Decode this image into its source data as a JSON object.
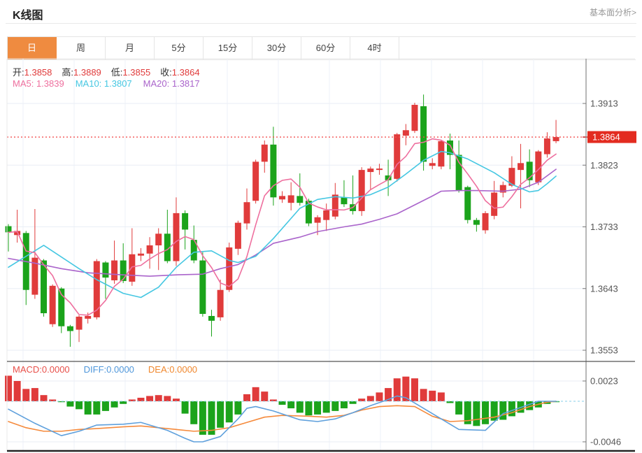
{
  "page": {
    "title": "K线图",
    "link": "基本面分析>"
  },
  "tabs": {
    "items": [
      {
        "label": "日",
        "active": true
      },
      {
        "label": "周",
        "active": false
      },
      {
        "label": "月",
        "active": false
      },
      {
        "label": "5分",
        "active": false
      },
      {
        "label": "15分",
        "active": false
      },
      {
        "label": "30分",
        "active": false
      },
      {
        "label": "60分",
        "active": false
      },
      {
        "label": "4时",
        "active": false
      }
    ]
  },
  "info": {
    "ohlc": [
      {
        "label": "开",
        "value": "1.3858"
      },
      {
        "label": "高",
        "value": "1.3889"
      },
      {
        "label": "低",
        "value": "1.3855"
      },
      {
        "label": "收",
        "value": "1.3864"
      }
    ],
    "ma": [
      {
        "label": "MA5",
        "value": "1.3839",
        "color": "#ee6f9e"
      },
      {
        "label": "MA10",
        "value": "1.3807",
        "color": "#45c7e2"
      },
      {
        "label": "MA20",
        "value": "1.3817",
        "color": "#aa64cb"
      }
    ]
  },
  "macd_info": [
    {
      "label": "MACD",
      "value": "0.0000",
      "color": "#e8504a"
    },
    {
      "label": "DIFF",
      "value": "0.0000",
      "color": "#4f97db"
    },
    {
      "label": "DEA",
      "value": "0.0000",
      "color": "#f0882e"
    }
  ],
  "colors": {
    "up": "#e03b3b",
    "down": "#1ba31b",
    "ma5": "#ee6f9e",
    "ma10": "#45c7e2",
    "ma20": "#aa64cb",
    "diff": "#5fa0dc",
    "dea": "#f58a3c",
    "grid": "#e9eef5",
    "axis": "#888888",
    "dotted_price": "#f25050",
    "price_tag_bg": "#e32b20",
    "price_tag_text": "#ffffff",
    "zero_dash": "#86cfe8",
    "tab_accent": "#ef8b40",
    "tick_text": "#555555",
    "separator": "#555555",
    "bottom_border": "#222222"
  },
  "chart_data": {
    "type": "candlestick",
    "panels": [
      "price",
      "macd"
    ],
    "legend": {
      "ma5": "MA5",
      "ma10": "MA10",
      "ma20": "MA20"
    },
    "price_axis": {
      "ticks": [
        1.3913,
        1.3823,
        1.3733,
        1.3643,
        1.3553
      ],
      "current_price": 1.3864
    },
    "macd_axis": {
      "ticks": [
        0.0023,
        -0.0046
      ],
      "zero": 0
    },
    "candles": [
      [
        1.3734,
        1.3737,
        1.3697,
        1.3725
      ],
      [
        1.3721,
        1.3758,
        1.371,
        1.3727
      ],
      [
        1.3724,
        1.3727,
        1.3619,
        1.3641
      ],
      [
        1.3634,
        1.3759,
        1.3628,
        1.3688
      ],
      [
        1.3684,
        1.3686,
        1.3602,
        1.3607
      ],
      [
        1.3591,
        1.3649,
        1.3587,
        1.3647
      ],
      [
        1.3643,
        1.3645,
        1.3578,
        1.3588
      ],
      [
        1.3588,
        1.359,
        1.3558,
        1.3581
      ],
      [
        1.3583,
        1.3604,
        1.3565,
        1.3602
      ],
      [
        1.3599,
        1.3608,
        1.3592,
        1.3603
      ],
      [
        1.3601,
        1.3686,
        1.3598,
        1.3683
      ],
      [
        1.3681,
        1.3683,
        1.3628,
        1.3659
      ],
      [
        1.3655,
        1.3713,
        1.365,
        1.3684
      ],
      [
        1.3684,
        1.3709,
        1.3651,
        1.3654
      ],
      [
        1.3653,
        1.3731,
        1.3647,
        1.3693
      ],
      [
        1.3691,
        1.3702,
        1.3683,
        1.3694
      ],
      [
        1.3694,
        1.3718,
        1.3672,
        1.3706
      ],
      [
        1.3706,
        1.3731,
        1.367,
        1.3723
      ],
      [
        1.3723,
        1.3758,
        1.368,
        1.3683
      ],
      [
        1.3683,
        1.3776,
        1.3676,
        1.3753
      ],
      [
        1.3753,
        1.3757,
        1.37,
        1.3729
      ],
      [
        1.3714,
        1.3735,
        1.368,
        1.3684
      ],
      [
        1.3684,
        1.3696,
        1.3602,
        1.3606
      ],
      [
        1.3603,
        1.3612,
        1.3573,
        1.3596
      ],
      [
        1.3601,
        1.3656,
        1.3596,
        1.3641
      ],
      [
        1.3641,
        1.371,
        1.3638,
        1.3703
      ],
      [
        1.3701,
        1.3742,
        1.3692,
        1.3739
      ],
      [
        1.3738,
        1.3789,
        1.3729,
        1.3769
      ],
      [
        1.3771,
        1.3831,
        1.3767,
        1.3828
      ],
      [
        1.3828,
        1.3859,
        1.3812,
        1.3853
      ],
      [
        1.3853,
        1.3879,
        1.3764,
        1.3776
      ],
      [
        1.3773,
        1.3785,
        1.3768,
        1.3778
      ],
      [
        1.3768,
        1.3798,
        1.3757,
        1.3779
      ],
      [
        1.3778,
        1.3811,
        1.3764,
        1.3768
      ],
      [
        1.3771,
        1.3774,
        1.3734,
        1.3738
      ],
      [
        1.3739,
        1.375,
        1.3721,
        1.3747
      ],
      [
        1.3743,
        1.3767,
        1.3727,
        1.3757
      ],
      [
        1.3748,
        1.3797,
        1.3744,
        1.378
      ],
      [
        1.3776,
        1.3801,
        1.3762,
        1.3766
      ],
      [
        1.3766,
        1.3808,
        1.3751,
        1.3756
      ],
      [
        1.3756,
        1.382,
        1.3749,
        1.3816
      ],
      [
        1.3813,
        1.3821,
        1.3787,
        1.3818
      ],
      [
        1.3816,
        1.3825,
        1.3809,
        1.3818
      ],
      [
        1.3808,
        1.3831,
        1.3778,
        1.3801
      ],
      [
        1.3803,
        1.387,
        1.3799,
        1.3868
      ],
      [
        1.3866,
        1.3883,
        1.3852,
        1.3874
      ],
      [
        1.3873,
        1.3914,
        1.387,
        1.3911
      ],
      [
        1.3909,
        1.3926,
        1.3815,
        1.3828
      ],
      [
        1.3822,
        1.3833,
        1.3817,
        1.3826
      ],
      [
        1.3821,
        1.386,
        1.3817,
        1.3858
      ],
      [
        1.3859,
        1.3869,
        1.3817,
        1.3838
      ],
      [
        1.3838,
        1.3859,
        1.3783,
        1.3786
      ],
      [
        1.3791,
        1.3793,
        1.3738,
        1.3743
      ],
      [
        1.3743,
        1.3746,
        1.3726,
        1.3736
      ],
      [
        1.3728,
        1.3756,
        1.3723,
        1.3753
      ],
      [
        1.3749,
        1.38,
        1.3744,
        1.3783
      ],
      [
        1.3783,
        1.3799,
        1.3776,
        1.3794
      ],
      [
        1.3793,
        1.3836,
        1.3791,
        1.3819
      ],
      [
        1.3816,
        1.3854,
        1.376,
        1.3826
      ],
      [
        1.3828,
        1.3846,
        1.3791,
        1.3801
      ],
      [
        1.3798,
        1.3845,
        1.3794,
        1.3843
      ],
      [
        1.3839,
        1.3871,
        1.3834,
        1.3862
      ],
      [
        1.3858,
        1.3889,
        1.3855,
        1.3864
      ]
    ],
    "ma10": [
      [
        0,
        1.3674
      ],
      [
        4,
        1.3706
      ],
      [
        8,
        1.3672
      ],
      [
        10,
        1.3656
      ],
      [
        13,
        1.3636
      ],
      [
        15,
        1.363
      ],
      [
        17,
        1.3645
      ],
      [
        19,
        1.3674
      ],
      [
        21,
        1.3696
      ],
      [
        23,
        1.3698
      ],
      [
        25,
        1.3684
      ],
      [
        26,
        1.3681
      ],
      [
        28,
        1.369
      ],
      [
        30,
        1.3716
      ],
      [
        33,
        1.376
      ],
      [
        35,
        1.3773
      ],
      [
        37,
        1.3777
      ],
      [
        39,
        1.3775
      ],
      [
        41,
        1.378
      ],
      [
        43,
        1.3791
      ],
      [
        45,
        1.381
      ],
      [
        47,
        1.383
      ],
      [
        49,
        1.3843
      ],
      [
        50,
        1.3841
      ],
      [
        52,
        1.3832
      ],
      [
        55,
        1.3812
      ],
      [
        57,
        1.3795
      ],
      [
        59,
        1.3784
      ],
      [
        60,
        1.3786
      ],
      [
        61,
        1.3796
      ],
      [
        62,
        1.3807
      ]
    ],
    "ma20": [
      [
        0,
        1.3687
      ],
      [
        3,
        1.368
      ],
      [
        6,
        1.3672
      ],
      [
        9,
        1.3666
      ],
      [
        13,
        1.3663
      ],
      [
        16,
        1.3661
      ],
      [
        19,
        1.3663
      ],
      [
        22,
        1.3664
      ],
      [
        24,
        1.3672
      ],
      [
        26,
        1.3678
      ],
      [
        28,
        1.3692
      ],
      [
        30,
        1.3709
      ],
      [
        33,
        1.3718
      ],
      [
        35,
        1.3726
      ],
      [
        38,
        1.3733
      ],
      [
        40,
        1.3737
      ],
      [
        42,
        1.3744
      ],
      [
        44,
        1.3752
      ],
      [
        46,
        1.3765
      ],
      [
        48,
        1.3778
      ],
      [
        49,
        1.3785
      ],
      [
        51,
        1.3786
      ],
      [
        53,
        1.3786
      ],
      [
        56,
        1.3785
      ],
      [
        58,
        1.3788
      ],
      [
        60,
        1.3798
      ],
      [
        62,
        1.3817
      ]
    ],
    "macd_hist": [
      0.0029,
      0.0023,
      0.0014,
      0.0015,
      0.0007,
      0.0002,
      -0.0001,
      -0.0006,
      -0.0009,
      -0.0015,
      -0.0015,
      -0.0011,
      -0.0007,
      -0.0003,
      0.0002,
      0.0004,
      0.0006,
      0.0007,
      0.0006,
      0.0003,
      -0.0014,
      -0.0026,
      -0.0038,
      -0.0038,
      -0.003,
      -0.0024,
      -0.0015,
      0.0008,
      0.0016,
      0.0011,
      0.0002,
      -0.0004,
      -0.0008,
      -0.0013,
      -0.0016,
      -0.0015,
      -0.0013,
      -0.0011,
      -0.0008,
      -0.0003,
      0.0003,
      0.0006,
      0.001,
      0.0015,
      0.0026,
      0.0028,
      0.0026,
      0.0014,
      0.0012,
      0.001,
      -0.0002,
      -0.0015,
      -0.0026,
      -0.0028,
      -0.0026,
      -0.0022,
      -0.0021,
      -0.0017,
      -0.0013,
      -0.001,
      -0.0007,
      -0.0003,
      -0.0001
    ],
    "diff": [
      [
        0,
        -0.0009
      ],
      [
        3,
        -0.0025
      ],
      [
        6,
        -0.0039
      ],
      [
        8,
        -0.0034
      ],
      [
        10,
        -0.0027
      ],
      [
        13,
        -0.0026
      ],
      [
        15,
        -0.0024
      ],
      [
        18,
        -0.0033
      ],
      [
        20,
        -0.0042
      ],
      [
        21,
        -0.0046
      ],
      [
        22,
        -0.0046
      ],
      [
        24,
        -0.004
      ],
      [
        26,
        -0.002
      ],
      [
        27,
        -0.0008
      ],
      [
        28,
        -0.0006
      ],
      [
        30,
        -0.0011
      ],
      [
        33,
        -0.0021
      ],
      [
        35,
        -0.0023
      ],
      [
        37,
        -0.002
      ],
      [
        39,
        -0.0013
      ],
      [
        41,
        -0.0005
      ],
      [
        43,
        0.0002
      ],
      [
        44,
        0.0006
      ],
      [
        45,
        0.0004
      ],
      [
        47,
        -0.0008
      ],
      [
        49,
        -0.002
      ],
      [
        51,
        -0.0032
      ],
      [
        54,
        -0.0033
      ],
      [
        56,
        -0.0014
      ],
      [
        58,
        -0.0007
      ],
      [
        60,
        0.0
      ],
      [
        62,
        0.0
      ]
    ],
    "dea": [
      [
        0,
        -0.0023
      ],
      [
        2,
        -0.003
      ],
      [
        4,
        -0.0034
      ],
      [
        6,
        -0.0034
      ],
      [
        8,
        -0.0032
      ],
      [
        10,
        -0.0031
      ],
      [
        13,
        -0.0029
      ],
      [
        15,
        -0.0028
      ],
      [
        17,
        -0.003
      ],
      [
        19,
        -0.0032
      ],
      [
        21,
        -0.0034
      ],
      [
        23,
        -0.0033
      ],
      [
        25,
        -0.003
      ],
      [
        27,
        -0.0024
      ],
      [
        29,
        -0.0018
      ],
      [
        31,
        -0.0016
      ],
      [
        34,
        -0.0017
      ],
      [
        36,
        -0.0018
      ],
      [
        38,
        -0.0016
      ],
      [
        40,
        -0.001
      ],
      [
        42,
        -0.0006
      ],
      [
        44,
        -0.0005
      ],
      [
        46,
        -0.0006
      ],
      [
        48,
        -0.0017
      ],
      [
        50,
        -0.0023
      ],
      [
        52,
        -0.0022
      ],
      [
        55,
        -0.0018
      ],
      [
        57,
        -0.0013
      ],
      [
        59,
        -0.0006
      ],
      [
        61,
        -0.0001
      ],
      [
        62,
        0.0
      ]
    ]
  }
}
